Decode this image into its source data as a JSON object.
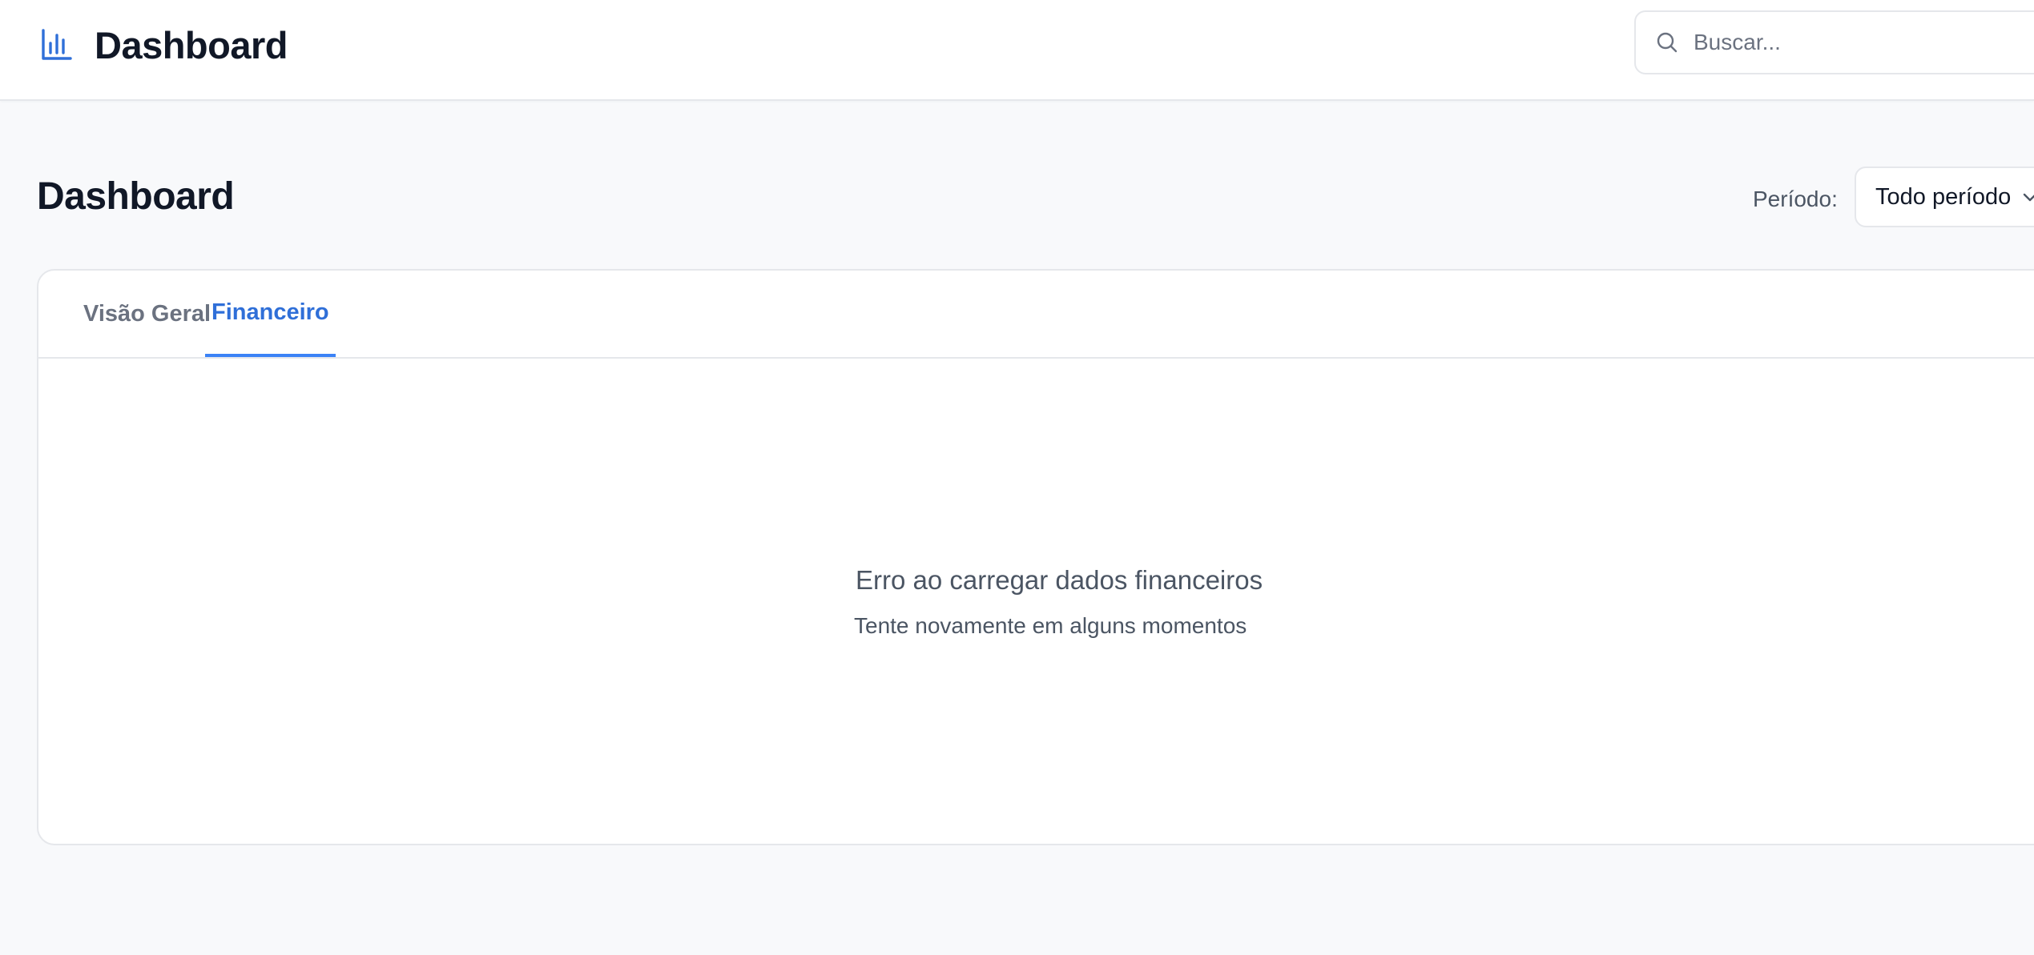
{
  "header": {
    "app_title": "Dashboard",
    "brand_icon": "bar-chart-icon",
    "accent_color": "#2f6fd8",
    "search": {
      "placeholder": "Buscar...",
      "value": "",
      "icon": "search-icon"
    }
  },
  "page": {
    "title": "Dashboard",
    "period": {
      "label": "Período:",
      "selected": "Todo período",
      "icon": "chevron-down-icon"
    }
  },
  "tabs": [
    {
      "label": "Visão Geral",
      "active": false
    },
    {
      "label": "Financeiro",
      "active": true
    }
  ],
  "content": {
    "error_title": "Erro ao carregar dados financeiros",
    "error_subtitle": "Tente novamente em alguns momentos"
  }
}
